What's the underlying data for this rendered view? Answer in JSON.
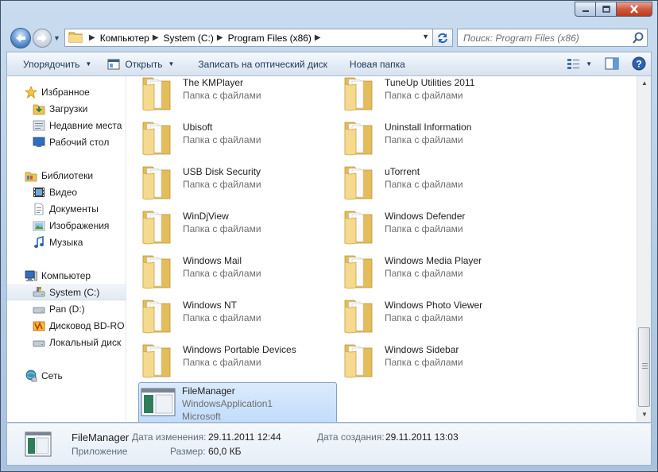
{
  "window": {
    "caption_buttons": [
      "minimize-icon",
      "maximize-icon",
      "close-icon"
    ]
  },
  "navigation": {
    "breadcrumbs": [
      "Компьютер",
      "System (C:)",
      "Program Files (x86)"
    ],
    "search_placeholder": "Поиск: Program Files (x86)"
  },
  "toolbar": {
    "organize": "Упорядочить",
    "open": "Открыть",
    "burn": "Записать на оптический диск",
    "new_folder": "Новая папка"
  },
  "sidebar": {
    "favorites": {
      "label": "Избранное",
      "items": [
        "Загрузки",
        "Недавние места",
        "Рабочий стол"
      ]
    },
    "libraries": {
      "label": "Библиотеки",
      "items": [
        "Видео",
        "Документы",
        "Изображения",
        "Музыка"
      ]
    },
    "computer": {
      "label": "Компьютер",
      "items": [
        "System (C:)",
        "Pan (D:)",
        "Дисковод BD-RO",
        "Локальный диск"
      ],
      "selected": "System (C:)"
    },
    "network": {
      "label": "Сеть"
    }
  },
  "files": {
    "folder_type": "Папка с файлами",
    "items": [
      {
        "name": "The KMPlayer",
        "sub": "Папка с файлами",
        "icon": "folder-icon"
      },
      {
        "name": "TuneUp Utilities 2011",
        "sub": "Папка с файлами",
        "icon": "folder-icon"
      },
      {
        "name": "Ubisoft",
        "sub": "Папка с файлами",
        "icon": "folder-icon"
      },
      {
        "name": "Uninstall Information",
        "sub": "Папка с файлами",
        "icon": "folder-icon"
      },
      {
        "name": "USB Disk Security",
        "sub": "Папка с файлами",
        "icon": "folder-icon"
      },
      {
        "name": "uTorrent",
        "sub": "Папка с файлами",
        "icon": "folder-icon"
      },
      {
        "name": "WinDjView",
        "sub": "Папка с файлами",
        "icon": "folder-icon"
      },
      {
        "name": "Windows Defender",
        "sub": "Папка с файлами",
        "icon": "folder-icon"
      },
      {
        "name": "Windows Mail",
        "sub": "Папка с файлами",
        "icon": "folder-icon"
      },
      {
        "name": "Windows Media Player",
        "sub": "Папка с файлами",
        "icon": "folder-icon"
      },
      {
        "name": "Windows NT",
        "sub": "Папка с файлами",
        "icon": "folder-icon"
      },
      {
        "name": "Windows Photo Viewer",
        "sub": "Папка с файлами",
        "icon": "folder-icon"
      },
      {
        "name": "Windows Portable Devices",
        "sub": "Папка с файлами",
        "icon": "folder-icon"
      },
      {
        "name": "Windows Sidebar",
        "sub": "Папка с файлами",
        "icon": "folder-icon"
      }
    ],
    "selected_app": {
      "name": "FileManager",
      "line2": "WindowsApplication1",
      "line3": "Microsoft",
      "icon": "application-icon"
    }
  },
  "details": {
    "name": "FileManager",
    "type": "Приложение",
    "modified_label": "Дата изменения:",
    "modified_value": "29.11.2011 12:44",
    "created_label": "Дата создания:",
    "created_value": "29.11.2011 13:03",
    "size_label": "Размер:",
    "size_value": "60,0 КБ"
  },
  "colors": {
    "selection": "#c1dcfc",
    "selection_border": "#7da2ce",
    "folder": "#f2d486",
    "command_text": "#1e395b"
  }
}
